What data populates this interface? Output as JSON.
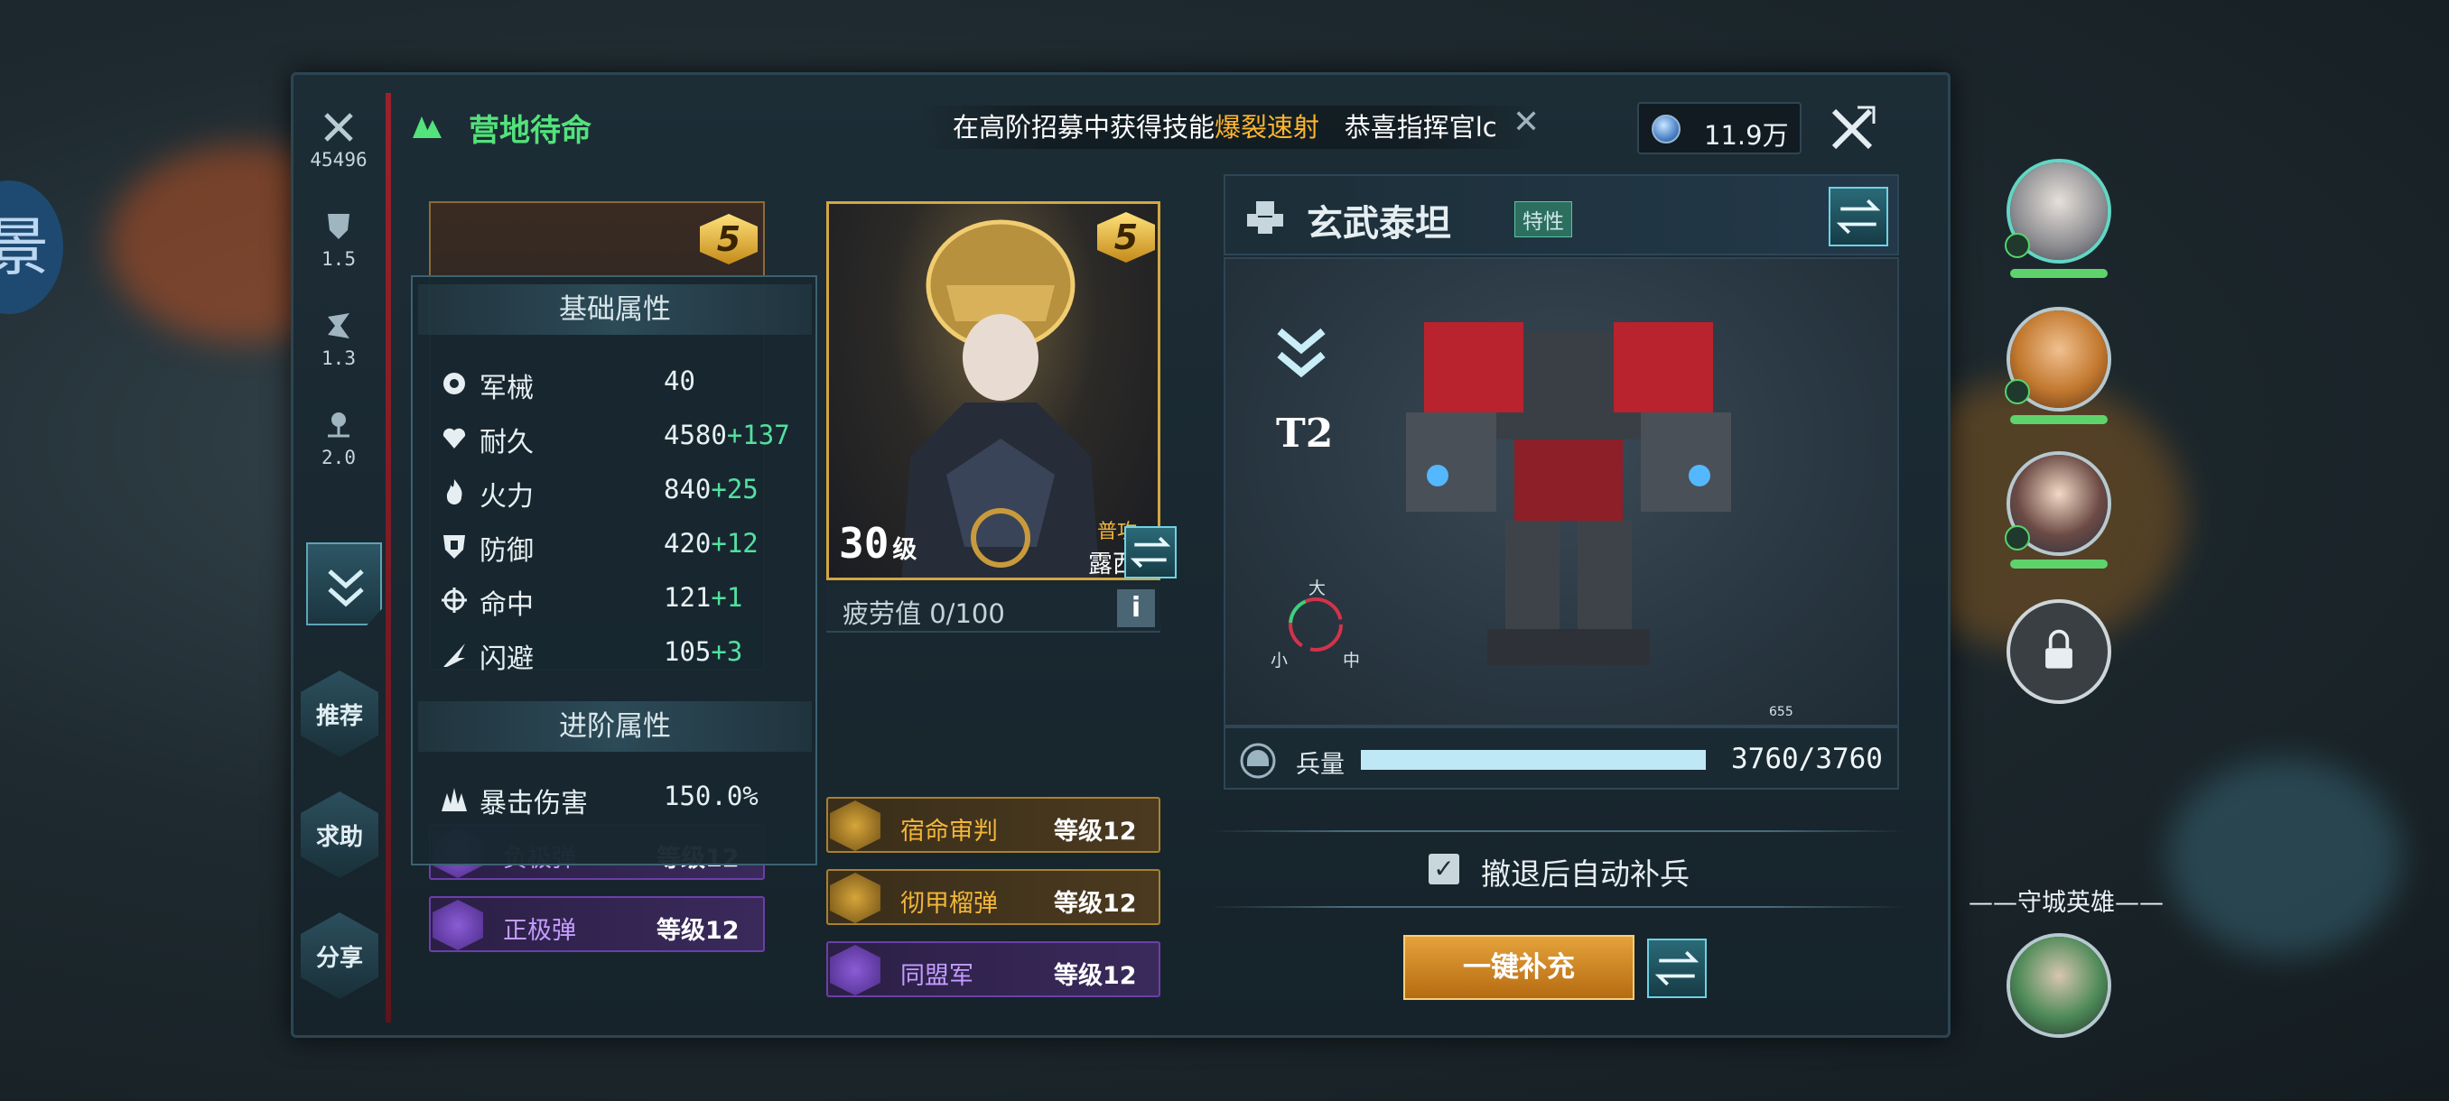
{
  "header": {
    "title": "营地待命",
    "ticker_prefix": "在高阶招募中获得技能",
    "ticker_highlight": "爆裂速射",
    "ticker_suffix": "恭喜指挥官lc",
    "currency": "11.9万"
  },
  "rail": {
    "power": "45496",
    "stat2": "1.5",
    "stat3": "1.3",
    "stat4": "2.0"
  },
  "side_buttons": {
    "recommend": "推荐",
    "help": "求助",
    "share": "分享"
  },
  "hero_left": {
    "skills": [
      {
        "name": "负极弹",
        "level": "等级12"
      },
      {
        "name": "正极弹",
        "level": "等级12"
      }
    ]
  },
  "attributes": {
    "basic_title": "基础属性",
    "rows": [
      {
        "icon": "mech-icon",
        "label": "军械",
        "base": "40",
        "bonus": ""
      },
      {
        "icon": "heart-icon",
        "label": "耐久",
        "base": "4580",
        "bonus": "+137"
      },
      {
        "icon": "fire-icon",
        "label": "火力",
        "base": "840",
        "bonus": "+25"
      },
      {
        "icon": "shield-icon",
        "label": "防御",
        "base": "420",
        "bonus": "+12"
      },
      {
        "icon": "crosshair-icon",
        "label": "命中",
        "base": "121",
        "bonus": "+1"
      },
      {
        "icon": "dodge-icon",
        "label": "闪避",
        "base": "105",
        "bonus": "+3"
      }
    ],
    "advanced_title": "进阶属性",
    "advanced_rows": [
      {
        "icon": "crit-icon",
        "label": "暴击伤害",
        "value": "150.0%"
      }
    ]
  },
  "hero_main": {
    "star": "5",
    "level": "30",
    "level_unit": "级",
    "attack_type": "普攻",
    "name": "露西",
    "fatigue": "疲劳值 0/100",
    "info": "i",
    "skills": [
      {
        "name": "宿命审判",
        "level": "等级12",
        "tier": "gold"
      },
      {
        "name": "彻甲榴弹",
        "level": "等级12",
        "tier": "gold"
      },
      {
        "name": "同盟军",
        "level": "等级12",
        "tier": "purple"
      }
    ]
  },
  "hero_left_star": "5",
  "mech": {
    "name": "玄武泰坦",
    "trait": "特性",
    "tier": "T2",
    "size_big": "大",
    "size_small": "小",
    "size_mid": "中",
    "troops_label": "兵量",
    "troops_value": "3760/3760",
    "troops_fill": 1.0,
    "marker": "655"
  },
  "auto_refill_label": "撤退后自动补兵",
  "refill_button": "一键补充",
  "defense_hero_label": "——守城英雄——",
  "left_bubble_char": "景",
  "colors": {
    "accent_green": "#53e27b",
    "highlight_orange": "#ffb62e",
    "bonus_green": "#52e0a0",
    "gold": "#d3a642",
    "purple": "#6c3fa8"
  }
}
